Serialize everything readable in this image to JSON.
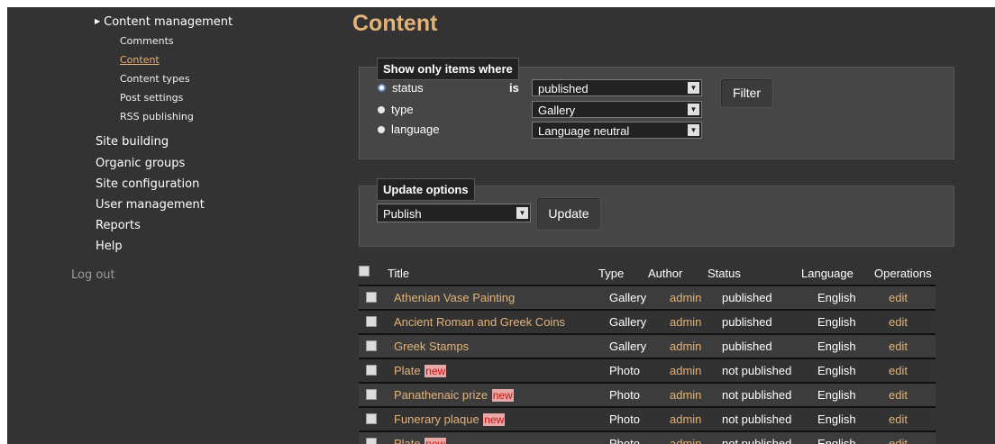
{
  "sidebar": {
    "parent": {
      "label": "Content management",
      "icon": "triangle-right-icon"
    },
    "sub_items": [
      {
        "label": "Comments",
        "active": false
      },
      {
        "label": "Content",
        "active": true
      },
      {
        "label": "Content types",
        "active": false
      },
      {
        "label": "Post settings",
        "active": false
      },
      {
        "label": "RSS publishing",
        "active": false
      }
    ],
    "top_items": [
      "Site building",
      "Organic groups",
      "Site configuration",
      "User management",
      "Reports",
      "Help"
    ],
    "logout": "Log out"
  },
  "page": {
    "title": "Content"
  },
  "filter": {
    "legend": "Show only items where",
    "radios": [
      {
        "label": "status",
        "selected": true
      },
      {
        "label": "type",
        "selected": false
      },
      {
        "label": "language",
        "selected": false
      }
    ],
    "is_label": "is",
    "selects": [
      "published",
      "Gallery",
      "Language neutral"
    ],
    "button": "Filter"
  },
  "update": {
    "legend": "Update options",
    "select": "Publish",
    "button": "Update"
  },
  "table": {
    "headers": [
      "Title",
      "Type",
      "Author",
      "Status",
      "Language",
      "Operations"
    ],
    "rows": [
      {
        "title": "Athenian Vase Painting",
        "new": "",
        "type": "Gallery",
        "author": "admin",
        "status": "published",
        "language": "English",
        "op": "edit"
      },
      {
        "title": "Ancient Roman and Greek Coins",
        "new": "",
        "type": "Gallery",
        "author": "admin",
        "status": "published",
        "language": "English",
        "op": "edit"
      },
      {
        "title": "Greek Stamps",
        "new": "",
        "type": "Gallery",
        "author": "admin",
        "status": "published",
        "language": "English",
        "op": "edit"
      },
      {
        "title": "Plate",
        "new": "new",
        "type": "Photo",
        "author": "admin",
        "status": "not published",
        "language": "English",
        "op": "edit"
      },
      {
        "title": "Panathenaic prize",
        "new": "new",
        "type": "Photo",
        "author": "admin",
        "status": "not published",
        "language": "English",
        "op": "edit"
      },
      {
        "title": "Funerary plaque",
        "new": "new",
        "type": "Photo",
        "author": "admin",
        "status": "not published",
        "language": "English",
        "op": "edit"
      },
      {
        "title": "Plate",
        "new": "new",
        "type": "Photo",
        "author": "admin",
        "status": "not published",
        "language": "English",
        "op": "edit"
      }
    ]
  },
  "colors": {
    "accent": "#e3b37a",
    "background": "#333333",
    "new_badge": "#e8a8a8"
  }
}
